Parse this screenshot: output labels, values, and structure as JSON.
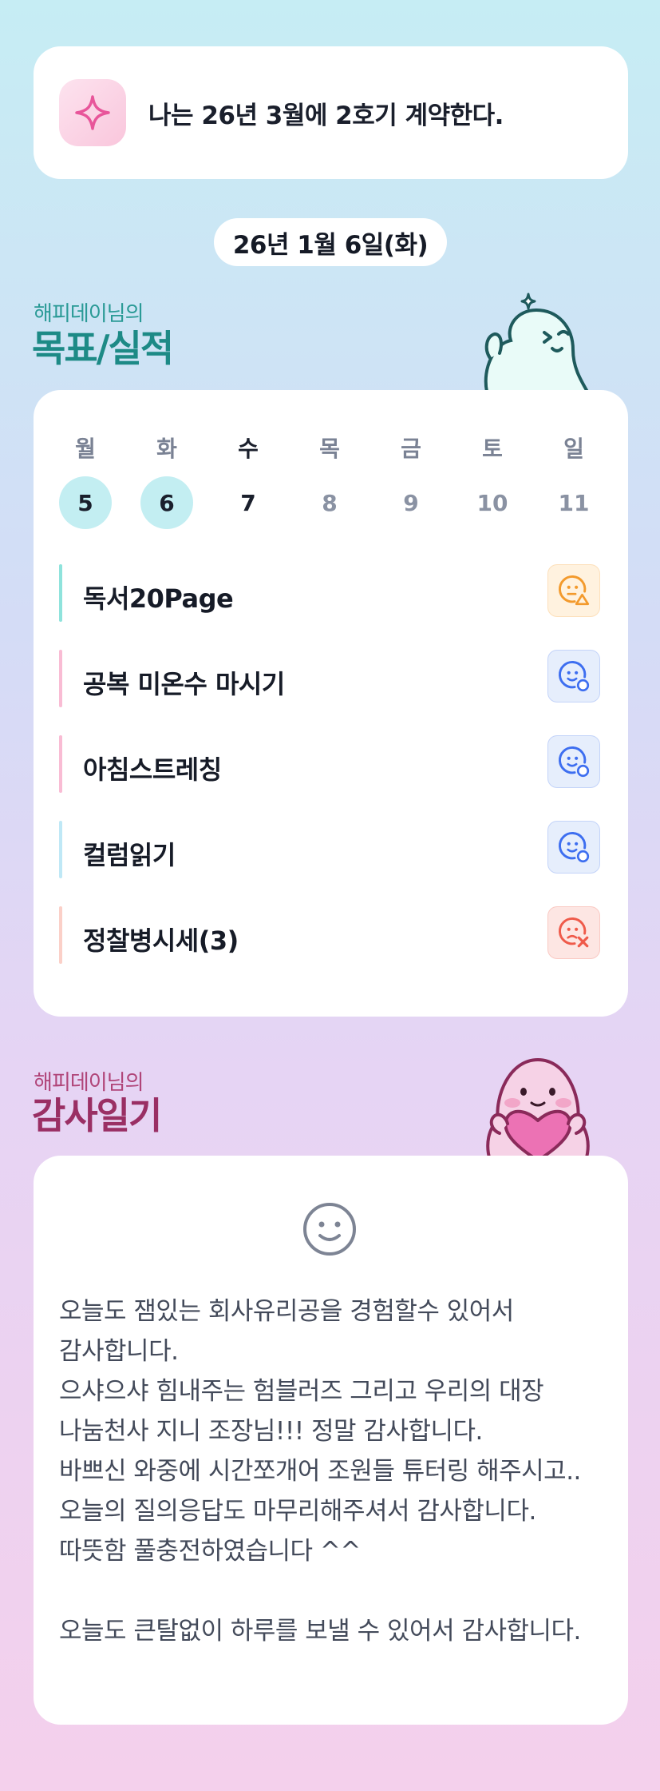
{
  "goal_banner": {
    "text": "나는 26년 3월에 2호기 계약한다.",
    "icon": "sparkle-icon"
  },
  "date": "26년 1월 6일(화)",
  "goals_section": {
    "subtitle": "해피데이님의",
    "title": "목표/실적",
    "mascot": "ghost-mascot-icon"
  },
  "week": {
    "days": [
      {
        "label": "월",
        "num": "5",
        "state": "done"
      },
      {
        "label": "화",
        "num": "6",
        "state": "done"
      },
      {
        "label": "수",
        "num": "7",
        "state": "today"
      },
      {
        "label": "목",
        "num": "8",
        "state": "future"
      },
      {
        "label": "금",
        "num": "9",
        "state": "future"
      },
      {
        "label": "토",
        "num": "10",
        "state": "future"
      },
      {
        "label": "일",
        "num": "11",
        "state": "future"
      }
    ]
  },
  "goals": [
    {
      "label": "독서20Page",
      "bar_color": "#8fe3dc",
      "status": "partial",
      "status_icon": "face-warning-icon",
      "status_color": "#f39a2c",
      "status_bg": "#fff2df"
    },
    {
      "label": "공복 미온수 마시기",
      "bar_color": "#f9bcd4",
      "status": "done",
      "status_icon": "face-check-icon",
      "status_color": "#3d6ef0",
      "status_bg": "#e6eefc"
    },
    {
      "label": "아침스트레칭",
      "bar_color": "#f9bcd4",
      "status": "done",
      "status_icon": "face-check-icon",
      "status_color": "#3d6ef0",
      "status_bg": "#e6eefc"
    },
    {
      "label": "컬럼읽기",
      "bar_color": "#bfe8f6",
      "status": "done",
      "status_icon": "face-check-icon",
      "status_color": "#3d6ef0",
      "status_bg": "#e6eefc"
    },
    {
      "label": "정찰병시세(3)",
      "bar_color": "#fbd0c8",
      "status": "failed",
      "status_icon": "face-fail-icon",
      "status_color": "#ef5a4a",
      "status_bg": "#fde6e3"
    }
  ],
  "gratitude_section": {
    "subtitle": "해피데이님의",
    "title": "감사일기",
    "mascot": "heart-mascot-icon",
    "mood_icon": "smile-face-icon",
    "lines": [
      "오늘도 잼있는 회사유리공을 경험할수 있어서 감사합니다.",
      "으샤으샤 힘내주는 험블러즈 그리고 우리의 대장 나눔천사 지니 조장님!!! 정말 감사합니다.",
      "바쁘신 와중에 시간쪼개어 조원들 튜터링 해주시고.. 오늘의 질의응답도  마무리해주셔서 감사합니다. 따뜻함 풀충전하였습니다 ^^",
      "",
      "오늘도 큰탈없이 하루를 보낼 수 있어서 감사합니다."
    ]
  },
  "colors": {
    "goals_title": "#1d8a86",
    "goals_subtitle": "#2a9a96",
    "gratitude_title": "#9a2f64",
    "gratitude_subtitle": "#b04478",
    "done_circle": "#c3eef2"
  }
}
